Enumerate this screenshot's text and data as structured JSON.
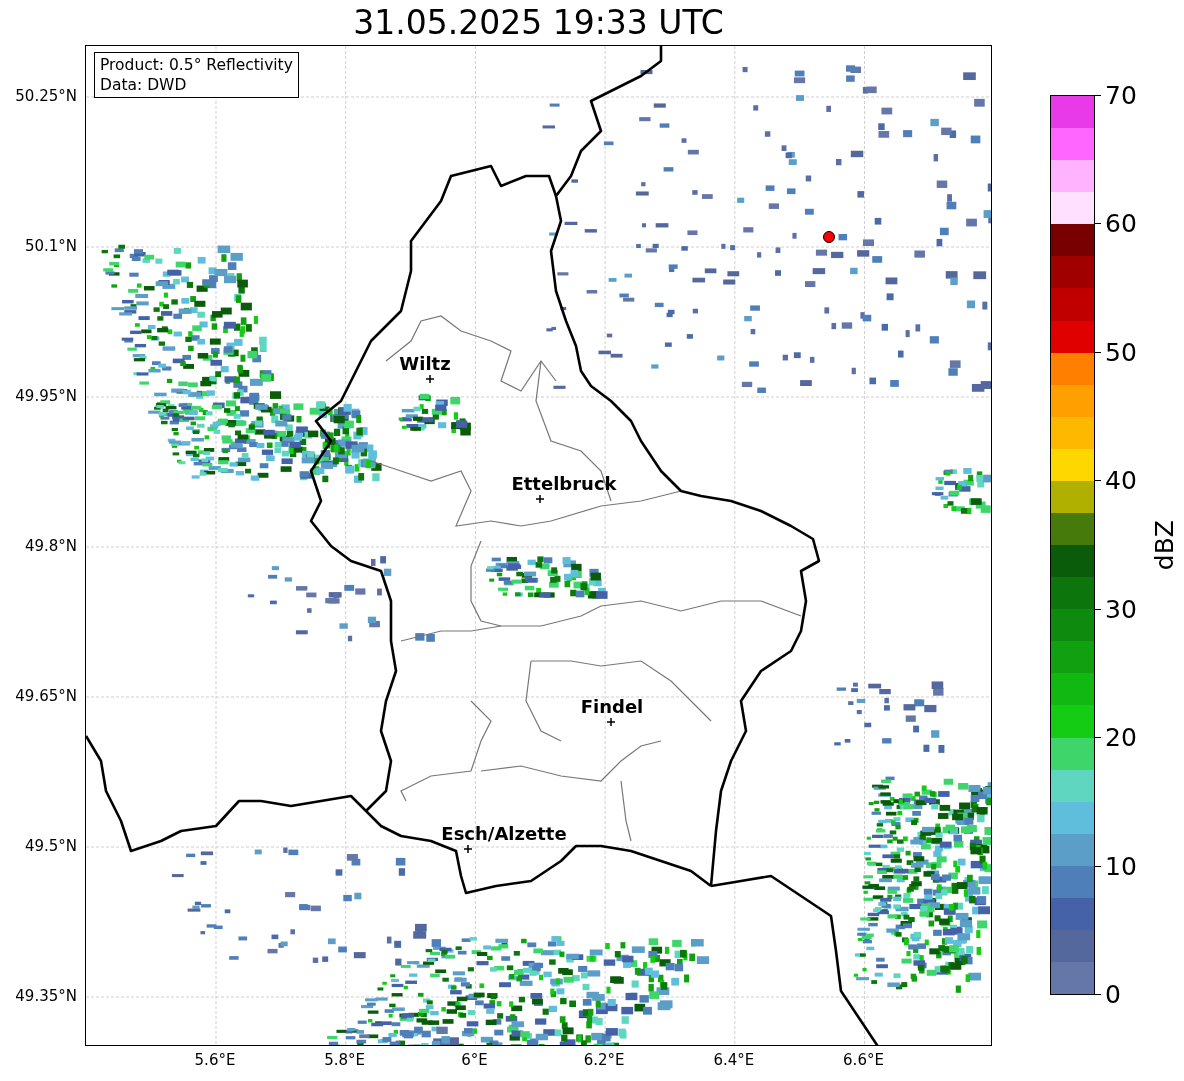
{
  "title": "31.05.2025 19:33 UTC",
  "info_box": {
    "lines": [
      "Product: 0.5° Reflectivity",
      "Data: DWD"
    ]
  },
  "y_ticks": [
    "50.25°N",
    "50.1°N",
    "49.95°N",
    "49.8°N",
    "49.65°N",
    "49.5°N",
    "49.35°N"
  ],
  "x_ticks": [
    "5.6°E",
    "5.8°E",
    "6°E",
    "6.2°E",
    "6.4°E",
    "6.6°E"
  ],
  "cities": [
    {
      "name": "Wiltz"
    },
    {
      "name": "Ettelbruck"
    },
    {
      "name": "Findel"
    },
    {
      "name": "Esch/Alzette"
    }
  ],
  "colorbar": {
    "label": "dBZ",
    "ticks": [
      "70",
      "60",
      "50",
      "40",
      "30",
      "20",
      "10",
      "0"
    ],
    "segments": [
      {
        "color": "#e93ae9"
      },
      {
        "color": "#ff66ff"
      },
      {
        "color": "#ffb3ff"
      },
      {
        "color": "#ffe0ff"
      },
      {
        "color": "#780000"
      },
      {
        "color": "#a00000"
      },
      {
        "color": "#c00000"
      },
      {
        "color": "#e00000"
      },
      {
        "color": "#ff8000"
      },
      {
        "color": "#ff9f00"
      },
      {
        "color": "#ffb800"
      },
      {
        "color": "#ffd700"
      },
      {
        "color": "#b0b000"
      },
      {
        "color": "#467a0a"
      },
      {
        "color": "#0a5c0a"
      },
      {
        "color": "#0c760c"
      },
      {
        "color": "#0e8a0e"
      },
      {
        "color": "#10a010"
      },
      {
        "color": "#12b812"
      },
      {
        "color": "#14cc14"
      },
      {
        "color": "#3ed66a"
      },
      {
        "color": "#5fd6c0"
      },
      {
        "color": "#5fbedc"
      },
      {
        "color": "#5b9ec8"
      },
      {
        "color": "#4f7fb8"
      },
      {
        "color": "#4561a8"
      },
      {
        "color": "#55689e"
      },
      {
        "color": "#6577a8"
      }
    ]
  }
}
